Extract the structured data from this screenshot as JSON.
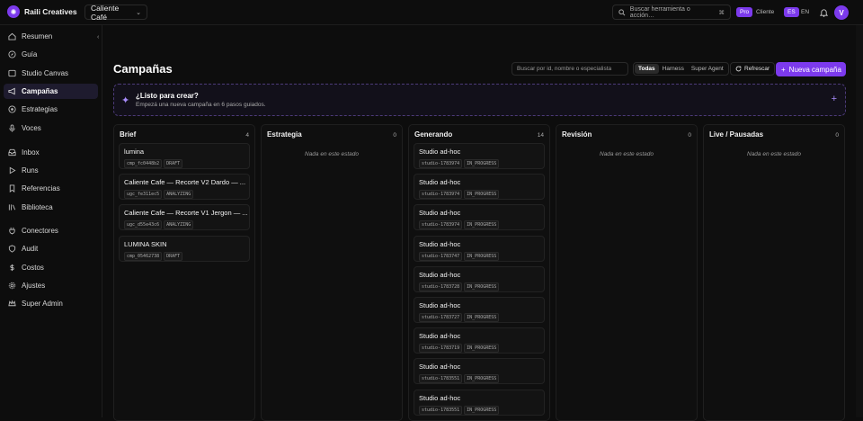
{
  "brand": {
    "name": "Raili Creatives"
  },
  "workspace": {
    "label": "Caliente Café"
  },
  "topbar": {
    "search_placeholder": "Buscar herramienta o acción…",
    "shortcut": "⌘",
    "plan_badge": "Pro",
    "role": "Cliente",
    "lang_active": "ES",
    "lang_other": "EN",
    "avatar_initial": "V"
  },
  "sidebar": {
    "items": [
      {
        "label": "Resumen",
        "icon": "home-icon"
      },
      {
        "label": "Guía",
        "icon": "compass-icon"
      },
      {
        "label": "Studio Canvas",
        "icon": "canvas-icon"
      },
      {
        "label": "Campañas",
        "icon": "megaphone-icon",
        "active": true
      },
      {
        "label": "Estrategias",
        "icon": "target-icon"
      },
      {
        "label": "Voces",
        "icon": "mic-icon"
      },
      {
        "label": "Inbox",
        "icon": "inbox-icon"
      },
      {
        "label": "Runs",
        "icon": "play-icon"
      },
      {
        "label": "Referencias",
        "icon": "bookmark-icon"
      },
      {
        "label": "Biblioteca",
        "icon": "library-icon"
      },
      {
        "label": "Conectores",
        "icon": "plug-icon"
      },
      {
        "label": "Audit",
        "icon": "shield-icon"
      },
      {
        "label": "Costos",
        "icon": "dollar-icon"
      },
      {
        "label": "Ajustes",
        "icon": "gear-icon"
      },
      {
        "label": "Super Admin",
        "icon": "crown-icon"
      }
    ]
  },
  "main": {
    "title": "Campañas",
    "search_placeholder": "Buscar por id, nombre o especialista",
    "filters": [
      "Todas",
      "Harness",
      "Super Agent"
    ],
    "refresh_label": "Refrescar",
    "new_label": "Nueva campaña",
    "banner": {
      "title": "¿Listo para crear?",
      "subtitle": "Empezá una nueva campaña en 6 pasos guiados."
    },
    "empty_label": "Nada en este estado",
    "columns": [
      {
        "name": "Brief",
        "count": "4",
        "cards": [
          {
            "title": "lumina",
            "id": "cmp_fc0448b2",
            "status": "DRAFT"
          },
          {
            "title": "Caliente Cafe — Recorte V2 Dardo — ...",
            "id": "ugc_fe311ec5",
            "status": "ANALYZING"
          },
          {
            "title": "Caliente Cafe — Recorte V1 Jergon — ...",
            "id": "ugc_d55e43c6",
            "status": "ANALYZING"
          },
          {
            "title": "LUMINA SKIN",
            "id": "cmp_05462738",
            "status": "DRAFT"
          }
        ]
      },
      {
        "name": "Estrategia",
        "count": "0",
        "cards": []
      },
      {
        "name": "Generando",
        "count": "14",
        "cards": [
          {
            "title": "Studio ad-hoc",
            "id": "studio-1783974",
            "status": "IN_PROGRESS"
          },
          {
            "title": "Studio ad-hoc",
            "id": "studio-1783974",
            "status": "IN_PROGRESS"
          },
          {
            "title": "Studio ad-hoc",
            "id": "studio-1783974",
            "status": "IN_PROGRESS"
          },
          {
            "title": "Studio ad-hoc",
            "id": "studio-1783747",
            "status": "IN_PROGRESS"
          },
          {
            "title": "Studio ad-hoc",
            "id": "studio-1783728",
            "status": "IN_PROGRESS"
          },
          {
            "title": "Studio ad-hoc",
            "id": "studio-1783727",
            "status": "IN_PROGRESS"
          },
          {
            "title": "Studio ad-hoc",
            "id": "studio-1783719",
            "status": "IN_PROGRESS"
          },
          {
            "title": "Studio ad-hoc",
            "id": "studio-1783551",
            "status": "IN_PROGRESS"
          },
          {
            "title": "Studio ad-hoc",
            "id": "studio-1783551",
            "status": "IN_PROGRESS"
          }
        ]
      },
      {
        "name": "Revisión",
        "count": "0",
        "cards": []
      },
      {
        "name": "Live / Pausadas",
        "count": "0",
        "cards": []
      }
    ]
  }
}
